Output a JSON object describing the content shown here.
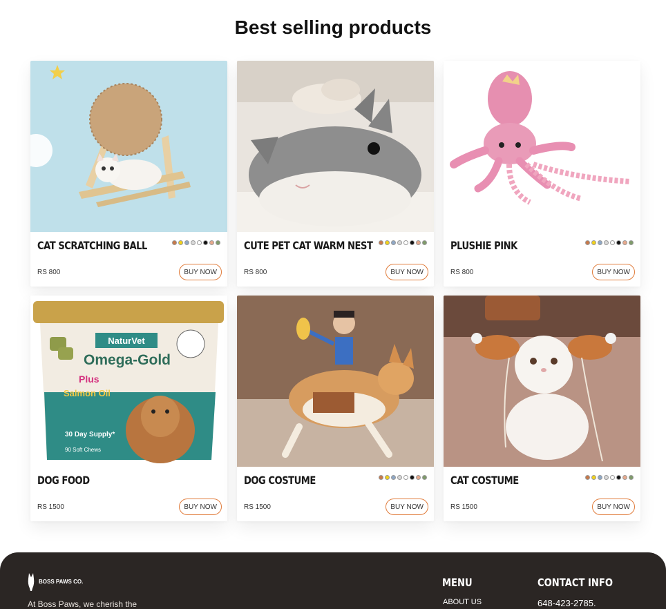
{
  "section": {
    "title": "Best selling products"
  },
  "swatch_colors": [
    "#c8794a",
    "#f2d21a",
    "#8fa8c6",
    "#d9d9d9",
    "#ffffff",
    "#111111",
    "#e7a98c",
    "#7f9b6a"
  ],
  "products": [
    {
      "name": "CAT SCRATCHING BALL",
      "price": "RS 800",
      "buy_label": "BUY NOW",
      "has_swatches": true,
      "image_icon": "cat-scratching-ball-photo"
    },
    {
      "name": "CUTE PET CAT WARM NEST",
      "price": "RS 800",
      "buy_label": "BUY NOW",
      "has_swatches": true,
      "image_icon": "shark-pet-bed-photo"
    },
    {
      "name": "PLUSHIE PINK",
      "price": "RS 800",
      "buy_label": "BUY NOW",
      "has_swatches": true,
      "image_icon": "pink-octopus-plush-photo"
    },
    {
      "name": "DOG FOOD",
      "price": "RS 1500",
      "buy_label": "BUY NOW",
      "has_swatches": false,
      "image_icon": "dog-food-tub-photo"
    },
    {
      "name": "DOG COSTUME",
      "price": "RS 1500",
      "buy_label": "BUY NOW",
      "has_swatches": true,
      "image_icon": "dog-costume-photo"
    },
    {
      "name": "CAT COSTUME",
      "price": "RS 1500",
      "buy_label": "BUY NOW",
      "has_swatches": true,
      "image_icon": "cat-costume-photo"
    }
  ],
  "food_label": {
    "brand": "NaturVet",
    "product": "Omega-Gold",
    "plus": "Plus",
    "sub": "Salmon Oil",
    "supply": "30 Day Supply*",
    "count": "90 Soft Chews"
  },
  "footer": {
    "logo_text": "BOSS PAWS CO.",
    "tagline": "At Boss Paws, we cherish the",
    "menu_heading": "MENU",
    "menu_items": [
      "ABOUT US"
    ],
    "contact_heading": "CONTACT INFO",
    "phone": "648-423-2785."
  }
}
